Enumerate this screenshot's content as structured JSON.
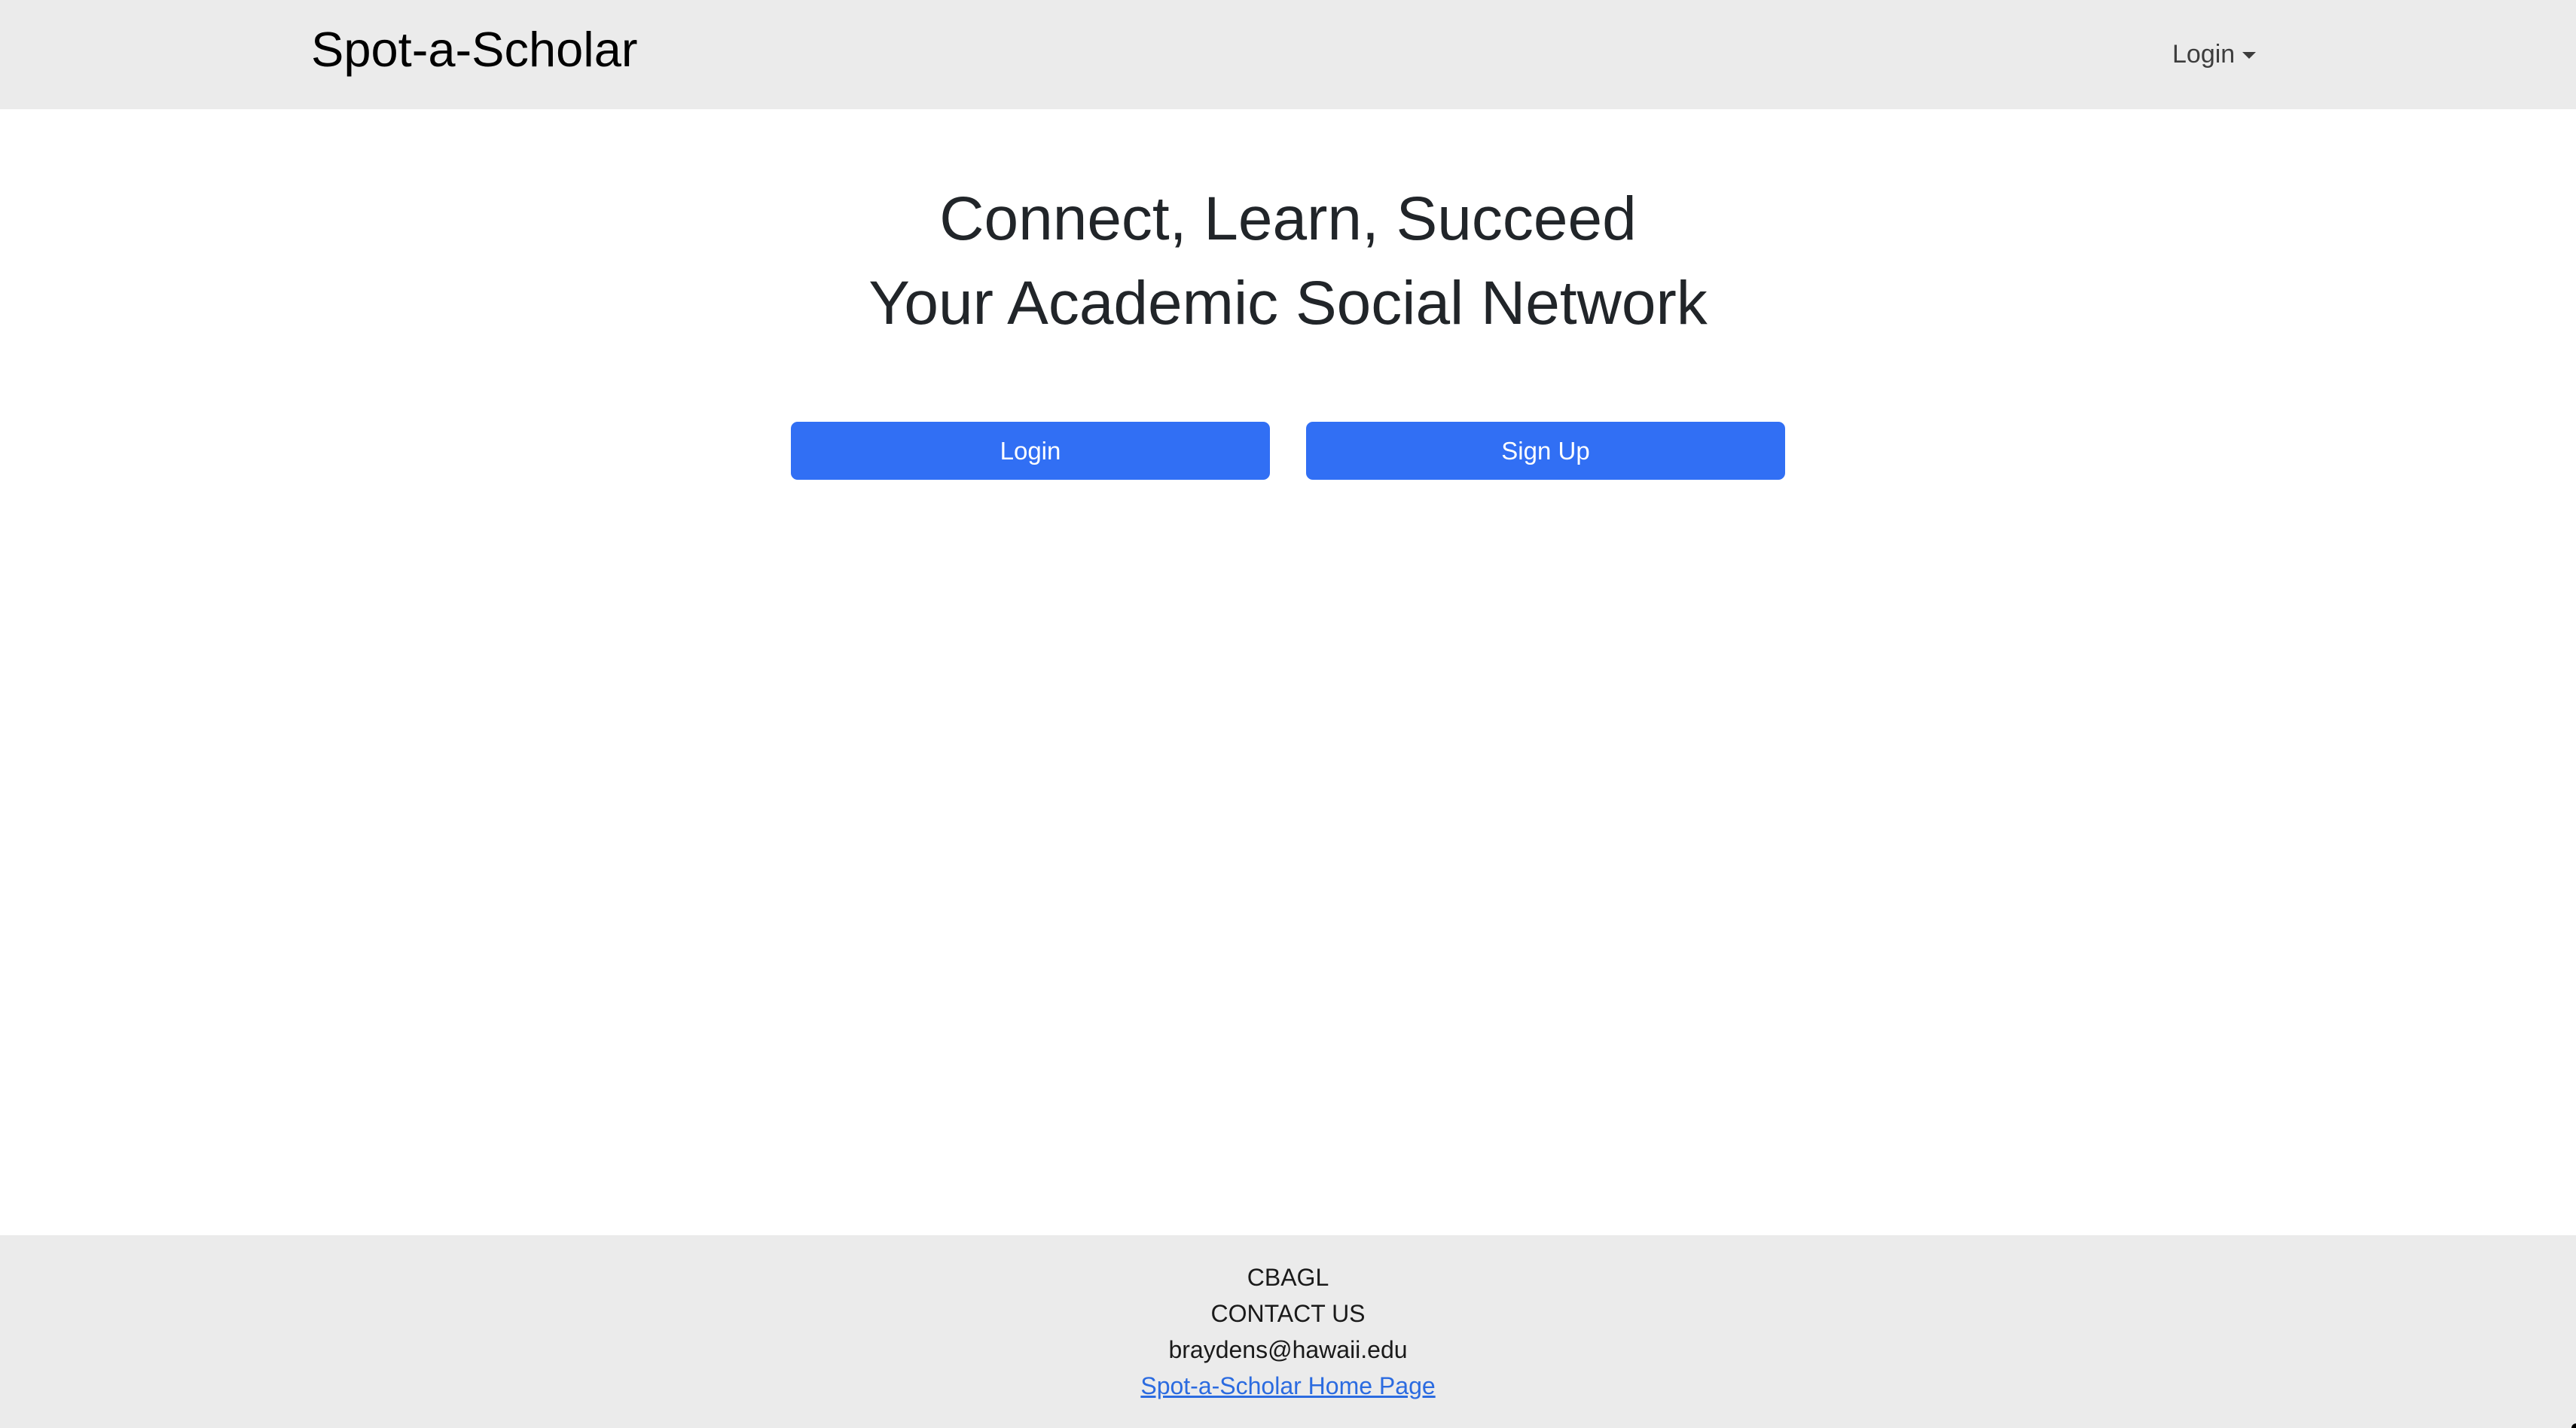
{
  "navbar": {
    "brand": "Spot-a-Scholar",
    "login_dropdown": "Login"
  },
  "hero": {
    "line1": "Connect, Learn, Succeed",
    "line2": "Your Academic Social Network"
  },
  "actions": {
    "login_label": "Login",
    "signup_label": "Sign Up"
  },
  "footer": {
    "org": "CBAGL",
    "contact_heading": "CONTACT US",
    "email": "braydens@hawaii.edu",
    "home_link": "Spot-a-Scholar Home Page"
  },
  "colors": {
    "navbar_bg": "#ebebeb",
    "primary_button": "#316ff4",
    "link": "#2b6be0"
  }
}
